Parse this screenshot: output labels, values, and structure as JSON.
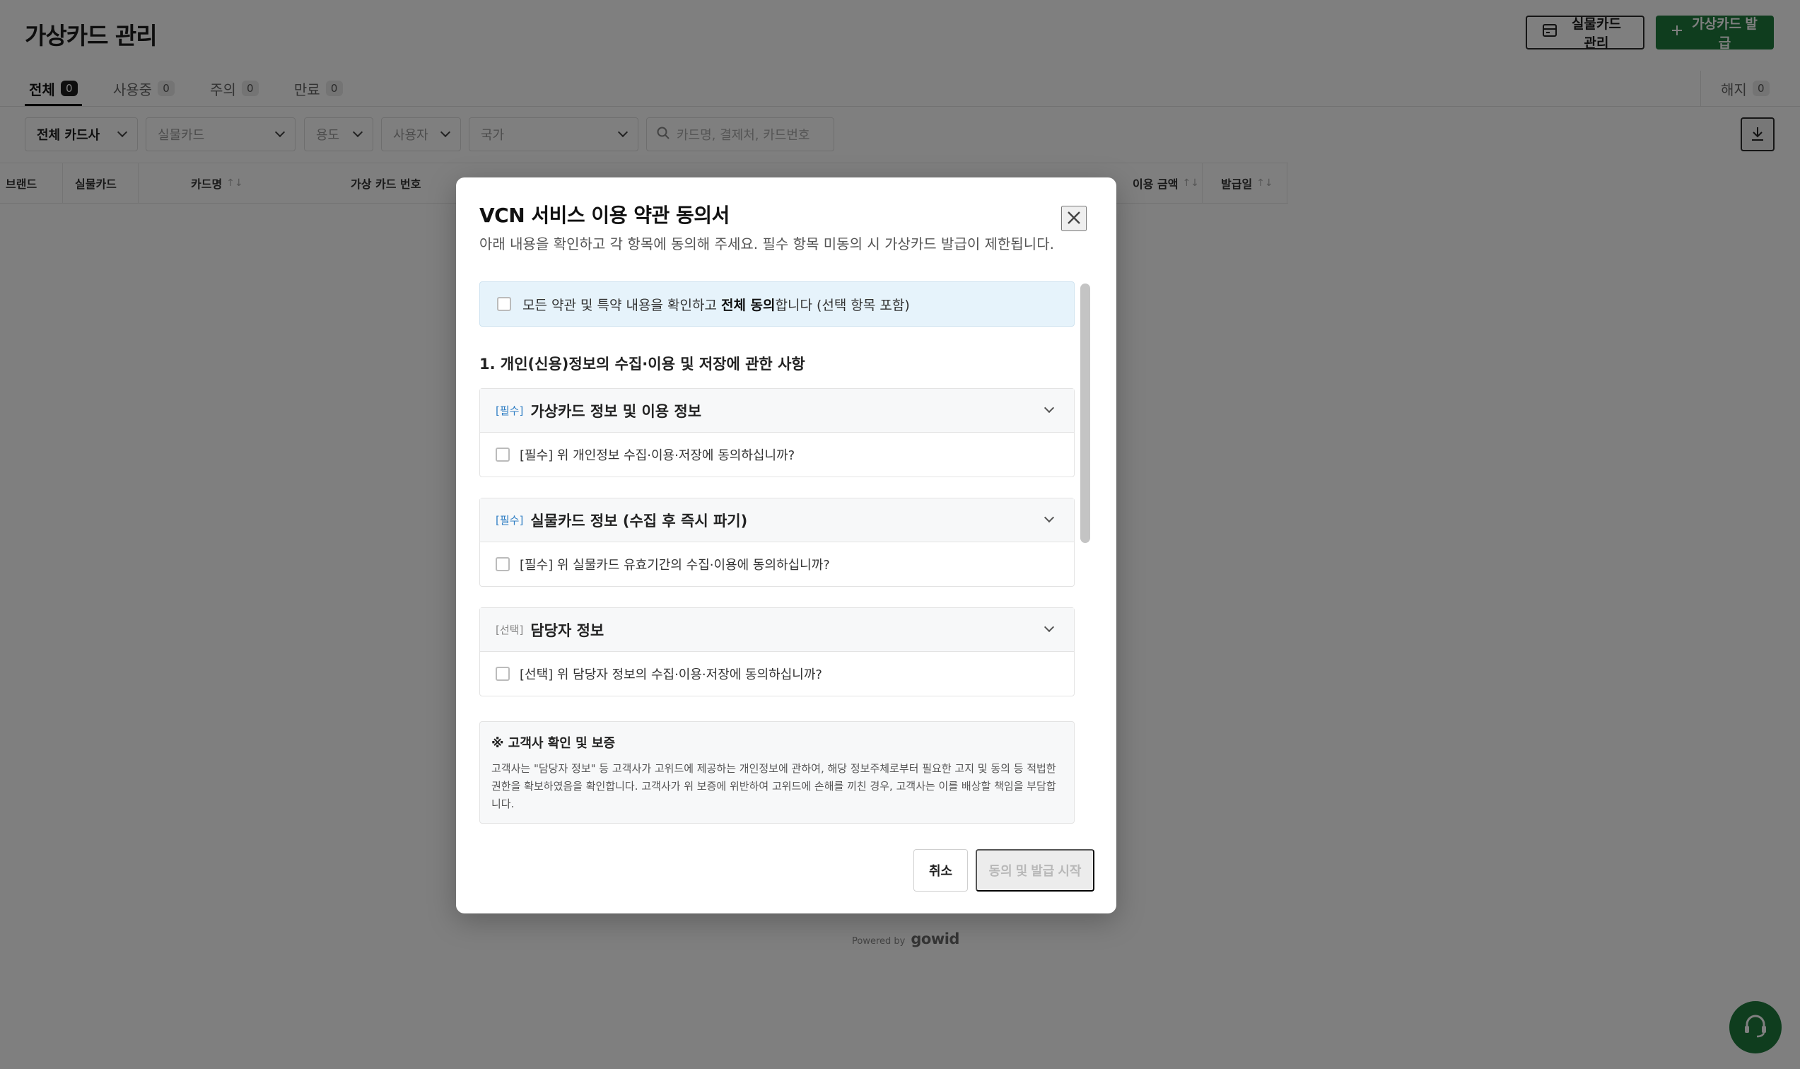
{
  "page": {
    "title": "가상카드 관리",
    "physical_card_button": "실물카드 관리",
    "issue_button": "가상카드 발급"
  },
  "tabs": [
    {
      "label": "전체",
      "count": "0"
    },
    {
      "label": "사용중",
      "count": "0"
    },
    {
      "label": "주의",
      "count": "0"
    },
    {
      "label": "만료",
      "count": "0"
    }
  ],
  "tab_right": {
    "label": "해지",
    "count": "0"
  },
  "filters": {
    "card_company": "전체 카드사",
    "physical_card": "실물카드",
    "purpose": "용도",
    "user": "사용자",
    "country": "국가",
    "search_placeholder": "카드명, 결제처, 카드번호"
  },
  "table": {
    "columns": [
      "브랜드",
      "실물카드",
      "카드명",
      "가상 카드 번호",
      "이용 금액",
      "발급일"
    ],
    "sort_glyph": "↑↓"
  },
  "footer": {
    "powered_by": "Powered by",
    "brand": "gowid"
  },
  "modal": {
    "title": "VCN 서비스 이용 약관 동의서",
    "subtitle": "아래 내용을 확인하고 각 항목에 동의해 주세요. 필수 항목 미동의 시 가상카드 발급이 제한됩니다.",
    "all_agree": {
      "prefix": "모든 약관 및 특약 내용을 확인하고 ",
      "bold": "전체 동의",
      "suffix": "합니다 (선택 항목 포함)"
    },
    "section_title": "1. 개인(신용)정보의 수집·이용 및 저장에 관한 사항",
    "items": [
      {
        "tag": "[필수]",
        "title": "가상카드 정보 및 이용 정보",
        "agree_text": "[필수] 위 개인정보 수집·이용·저장에 동의하십니까?"
      },
      {
        "tag": "[필수]",
        "title": "실물카드 정보 (수집 후 즉시 파기)",
        "agree_text": "[필수] 위 실물카드 유효기간의 수집·이용에 동의하십니까?"
      },
      {
        "tag": "[선택]",
        "title": "담당자 정보",
        "agree_text": "[선택] 위 담당자 정보의 수집·이용·저장에 동의하십니까?"
      }
    ],
    "notice": {
      "title": "※ 고객사 확인 및 보증",
      "text": "고객사는 \"담당자 정보\" 등 고객사가 고위드에 제공하는 개인정보에 관하여, 해당 정보주체로부터 필요한 고지 및 동의 등 적법한 권한을 확보하였음을 확인합니다. 고객사가 위 보증에 위반하여 고위드에 손해를 끼친 경우, 고객사는 이를 배상할 책임을 부담합니다."
    },
    "cancel_label": "취소",
    "start_label": "동의 및 발급 시작"
  },
  "colors": {
    "brand_green": "#1f7a3c",
    "accent_blue": "#2f7ec4",
    "all_agree_bg": "#e6f3fb"
  }
}
